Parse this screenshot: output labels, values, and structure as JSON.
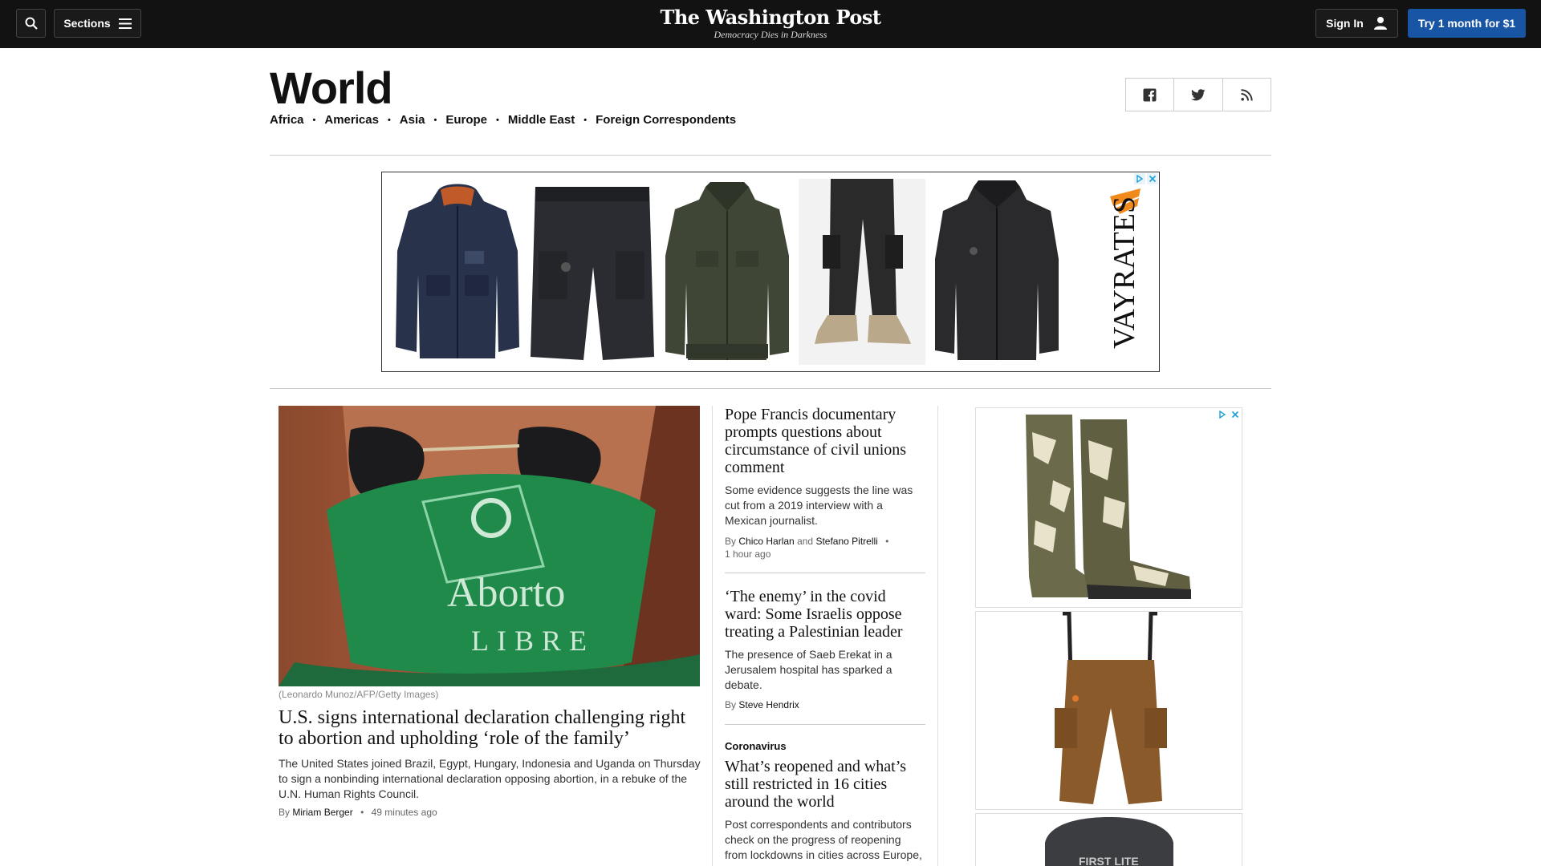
{
  "header": {
    "search_icon": "search-icon",
    "sections_label": "Sections",
    "logo": "The Washington Post",
    "tagline": "Democracy Dies in Darkness",
    "signin_label": "Sign In",
    "trial_label": "Try 1 month for $1",
    "accent": "#1955a5"
  },
  "section": {
    "title": "World",
    "subnav": [
      "Africa",
      "Americas",
      "Asia",
      "Europe",
      "Middle East",
      "Foreign Correspondents"
    ],
    "social": [
      "facebook-icon",
      "twitter-icon",
      "rss-icon"
    ]
  },
  "ad_banner": {
    "brand": "VAYRATES",
    "products": [
      "jacket",
      "shorts",
      "jacket",
      "pants",
      "jacket"
    ]
  },
  "lead": {
    "caption": "(Leonardo Munoz/AFP/Getty Images)",
    "image_text_1": "Aborto",
    "image_text_2": "LIBRE",
    "headline": "U.S. signs international declaration challenging right to abortion and upholding ‘role of the family’",
    "blurb": "The United States joined Brazil, Egypt, Hungary, Indonesia and Uganda on Thursday to sign a nonbinding international declaration opposing abortion, in a rebuke of the U.N. Human Rights Council.",
    "by": "By",
    "author": "Miriam Berger",
    "time": "49 minutes ago"
  },
  "stories": [
    {
      "headline": "Pope Francis documentary prompts questions about circumstance of civil unions comment",
      "blurb": "Some evidence suggests the line was cut from a 2019 interview with a Mexican journalist.",
      "by": "By",
      "author1": "Chico Harlan",
      "and": "and",
      "author2": "Stefano Pitrelli",
      "time": "1 hour ago"
    },
    {
      "headline": "‘The enemy’ in the covid ward: Some Israelis oppose treating a Palestinian leader",
      "blurb": "The presence of Saeb Erekat in a Jerusalem hospital has sparked a debate.",
      "by": "By",
      "author1": "Steve Hendrix"
    },
    {
      "kicker": "Coronavirus",
      "headline": "What’s reopened and what’s still restricted in 16 cities around the world",
      "blurb": "Post correspondents and contributors check on the progress of reopening from lockdowns in cities across Europe,"
    }
  ],
  "right_ad": {
    "hoodie_text": "FIRST LITE"
  }
}
